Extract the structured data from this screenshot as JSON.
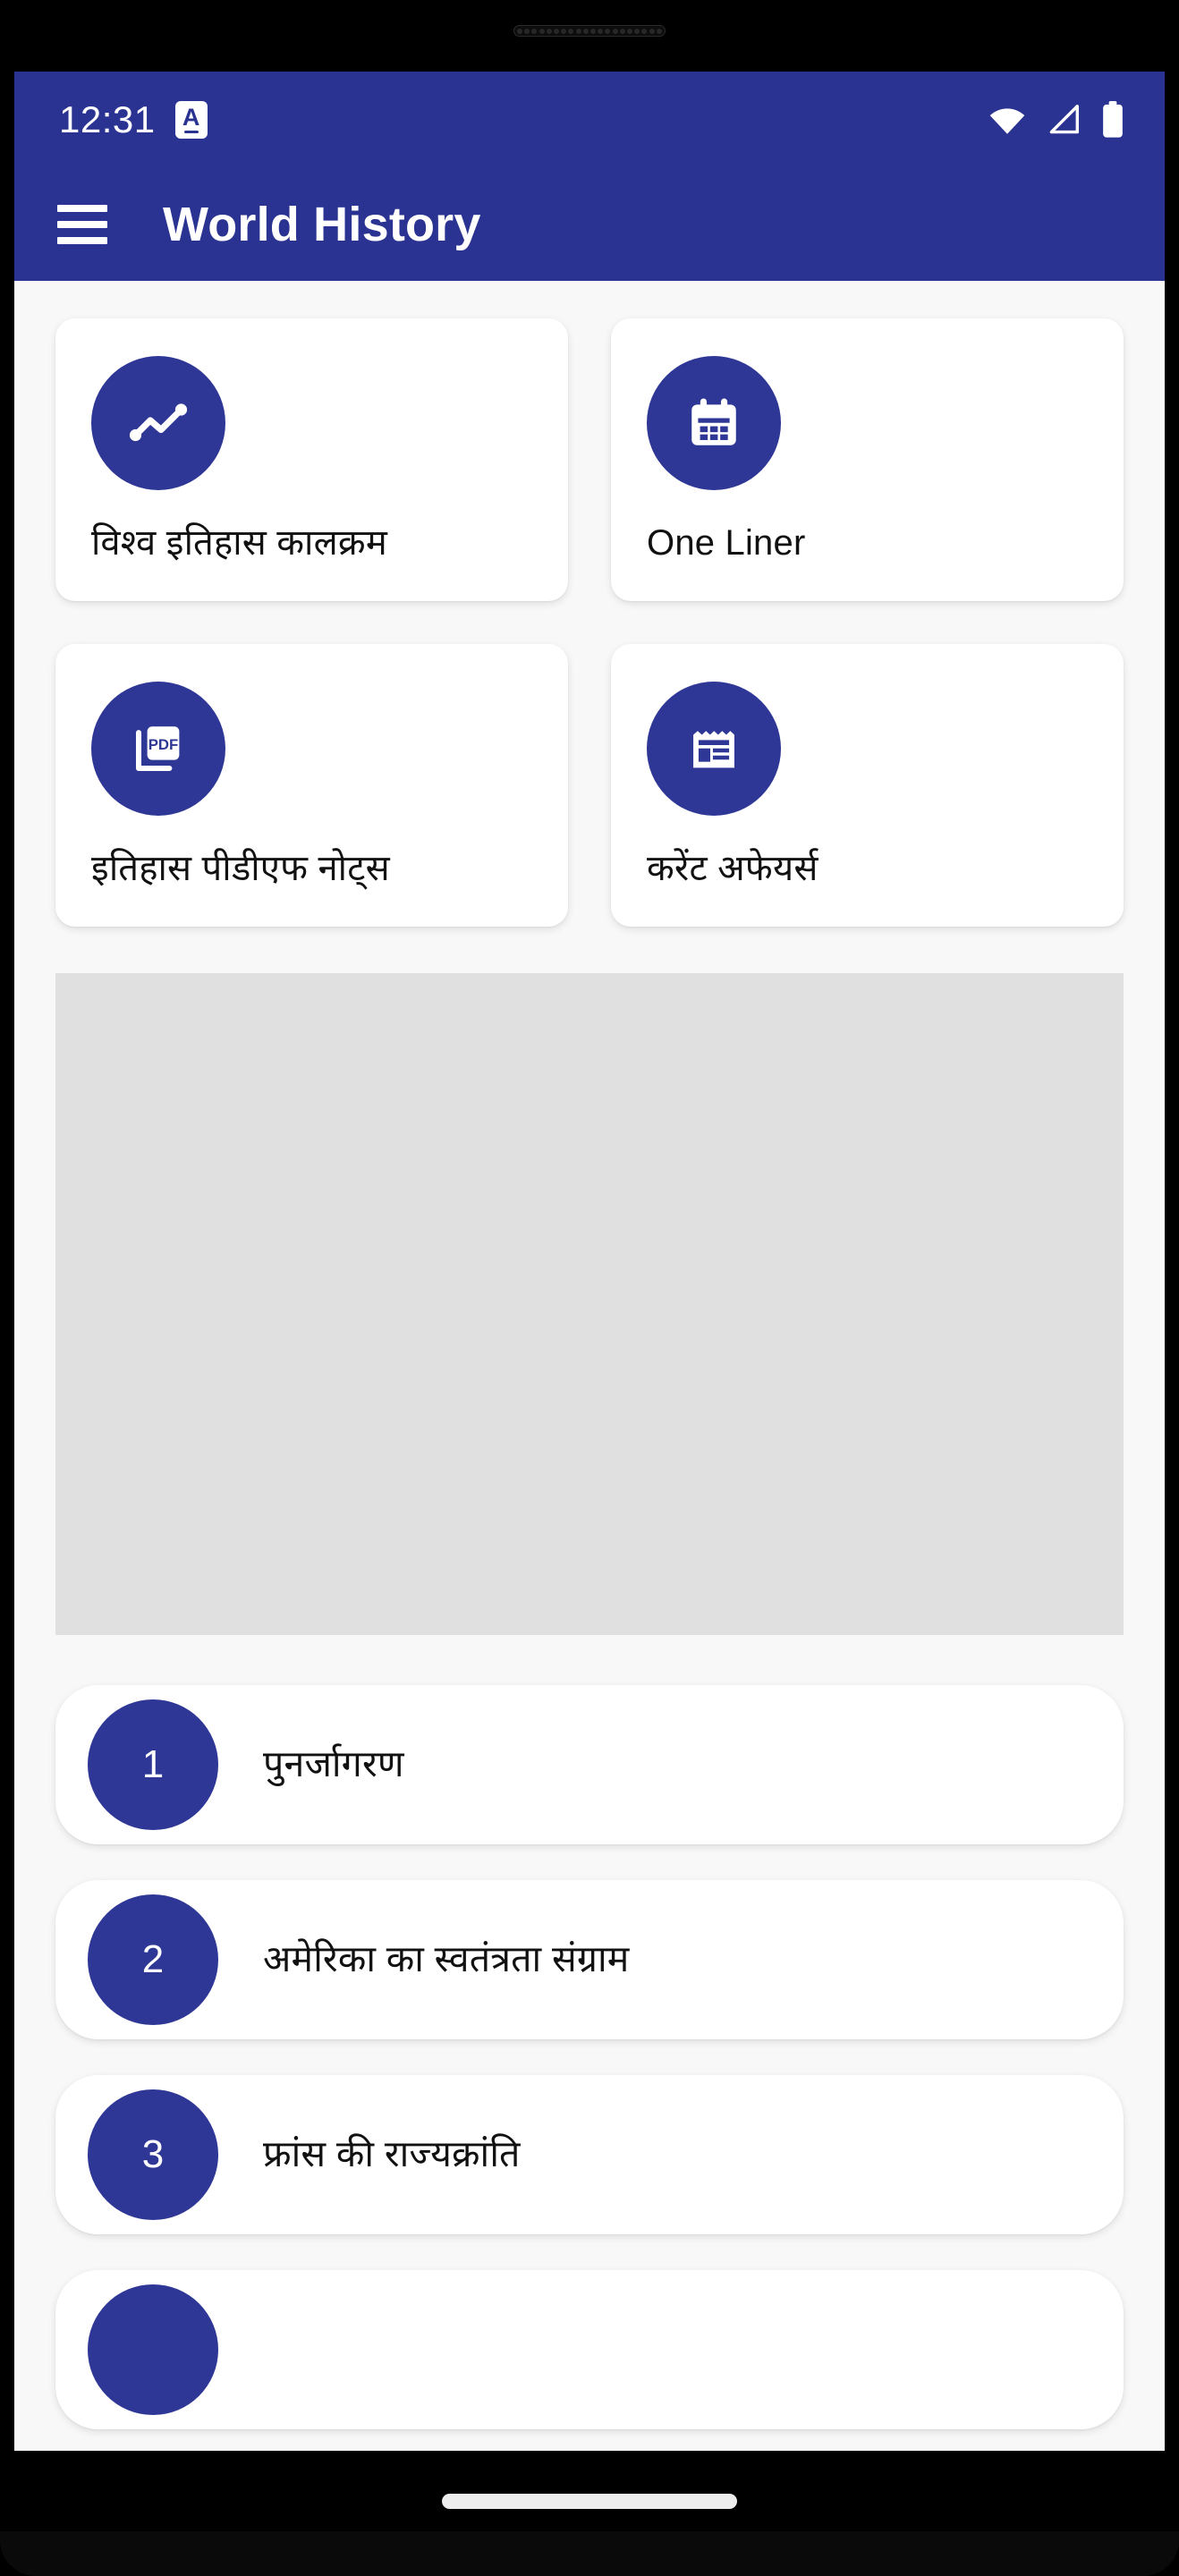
{
  "status_bar": {
    "time": "12:31",
    "notification_badge": "A",
    "icons": {
      "wifi": "wifi-icon",
      "signal": "signal-no-service-icon",
      "battery": "battery-full-icon"
    }
  },
  "app_bar": {
    "menu_icon": "hamburger-menu-icon",
    "title": "World History"
  },
  "feature_cards": [
    {
      "label": "विश्व इतिहास कालक्रम",
      "icon": "trending-line-chart-icon"
    },
    {
      "label": "One Liner",
      "icon": "calendar-icon"
    },
    {
      "label": "इतिहास पीडीएफ नोट्स",
      "icon": "pdf-document-icon"
    },
    {
      "label": "करेंट अफेयर्स",
      "icon": "newspaper-icon"
    }
  ],
  "topics": [
    {
      "number": "1",
      "label": "पुनर्जागरण"
    },
    {
      "number": "2",
      "label": "अमेरिका का स्वतंत्रता संग्राम"
    },
    {
      "number": "3",
      "label": "फ्रांस की राज्यक्रांति"
    }
  ],
  "colors": {
    "primary": "#2b3392",
    "accent_circle": "#2f3796",
    "page_background": "#f8f8f8",
    "card_background": "#ffffff",
    "placeholder": "#e0e0e0",
    "text_primary": "#111111",
    "on_primary": "#ffffff"
  }
}
